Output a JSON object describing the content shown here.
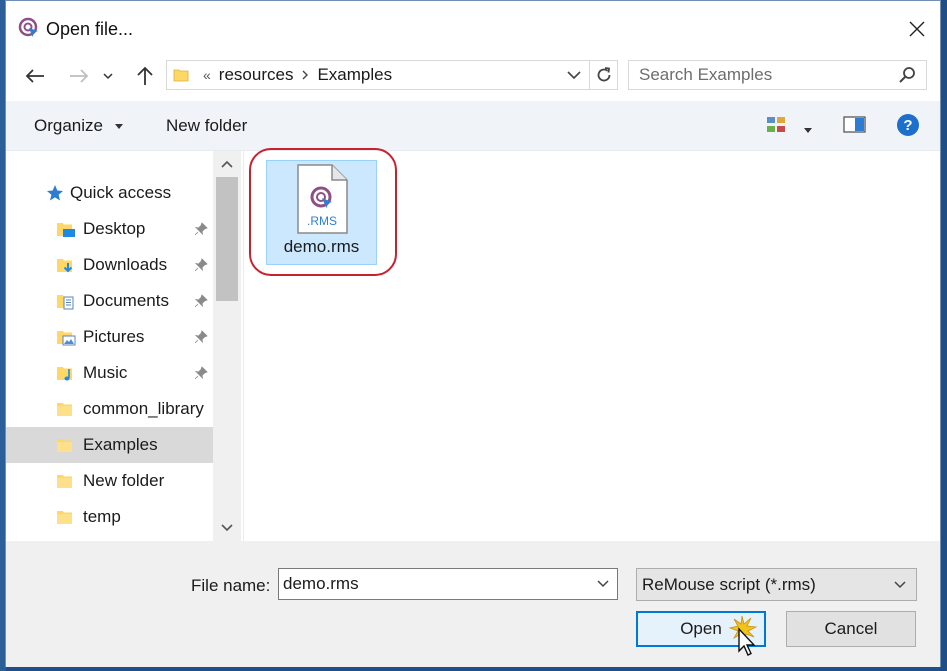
{
  "window": {
    "title": "Open file..."
  },
  "address": {
    "overflow": "«",
    "crumbs": [
      "resources",
      "Examples"
    ]
  },
  "search": {
    "placeholder": "Search Examples"
  },
  "toolbar": {
    "organize_label": "Organize",
    "new_folder_label": "New folder"
  },
  "nav_pane": {
    "quick_access_label": "Quick access",
    "items": [
      {
        "label": "Desktop",
        "pinned": true,
        "icon": "desktop-folder-icon"
      },
      {
        "label": "Downloads",
        "pinned": true,
        "icon": "downloads-folder-icon"
      },
      {
        "label": "Documents",
        "pinned": true,
        "icon": "documents-folder-icon"
      },
      {
        "label": "Pictures",
        "pinned": true,
        "icon": "pictures-folder-icon"
      },
      {
        "label": "Music",
        "pinned": true,
        "icon": "music-folder-icon"
      },
      {
        "label": "common_library",
        "pinned": false,
        "icon": "folder-icon"
      },
      {
        "label": "Examples",
        "pinned": false,
        "icon": "folder-icon",
        "selected": true
      },
      {
        "label": "New folder",
        "pinned": false,
        "icon": "folder-icon"
      },
      {
        "label": "temp",
        "pinned": false,
        "icon": "folder-icon"
      }
    ]
  },
  "files": [
    {
      "name": "demo.rms",
      "badge": ".RMS",
      "selected": true
    }
  ],
  "bottom": {
    "file_name_label": "File name:",
    "file_name_value": "demo.rms",
    "filter_value": "ReMouse script (*.rms)",
    "open_label": "Open",
    "cancel_label": "Cancel"
  },
  "colors": {
    "accent": "#0078d7",
    "selection": "#cce8ff",
    "highlight_ring": "#c8202d",
    "folder": "#ffd766"
  }
}
